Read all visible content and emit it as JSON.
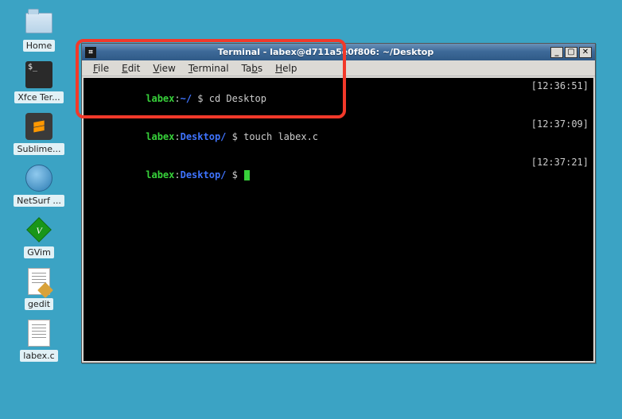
{
  "desktop": {
    "icons": [
      {
        "name": "home-folder",
        "label": "Home",
        "type": "folder"
      },
      {
        "name": "xfce-terminal",
        "label": "Xfce Ter...",
        "type": "term"
      },
      {
        "name": "sublime-text",
        "label": "Sublime...",
        "type": "sublime"
      },
      {
        "name": "netsurf",
        "label": "NetSurf ...",
        "type": "netsurf"
      },
      {
        "name": "gvim",
        "label": "GVim",
        "type": "gvim"
      },
      {
        "name": "gedit",
        "label": "gedit",
        "type": "gedit"
      },
      {
        "name": "labex-c-file",
        "label": "labex.c",
        "type": "textfile"
      }
    ]
  },
  "terminal": {
    "title": "Terminal - labex@d711a5e0f806: ~/Desktop",
    "menus": {
      "file": "File",
      "edit": "Edit",
      "view": "View",
      "terminal": "Terminal",
      "tabs": "Tabs",
      "help": "Help"
    },
    "window_buttons": {
      "minimize": "_",
      "maximize": "▢",
      "close": "✕"
    },
    "lines": [
      {
        "user": "labex",
        "sep": ":",
        "path": "~/",
        "prompt": " $ ",
        "cmd": "cd Desktop",
        "ts": "[12:36:51]"
      },
      {
        "user": "labex",
        "sep": ":",
        "path": "Desktop/",
        "prompt": " $ ",
        "cmd": "touch labex.c",
        "ts": "[12:37:09]"
      },
      {
        "user": "labex",
        "sep": ":",
        "path": "Desktop/",
        "prompt": " $ ",
        "cmd": "",
        "ts": "[12:37:21]",
        "cursor": true
      }
    ]
  },
  "colors": {
    "desktop_bg": "#3ba3c4",
    "highlight": "#f2392a",
    "term_green": "#37d13a",
    "term_blue": "#3f74ff"
  }
}
